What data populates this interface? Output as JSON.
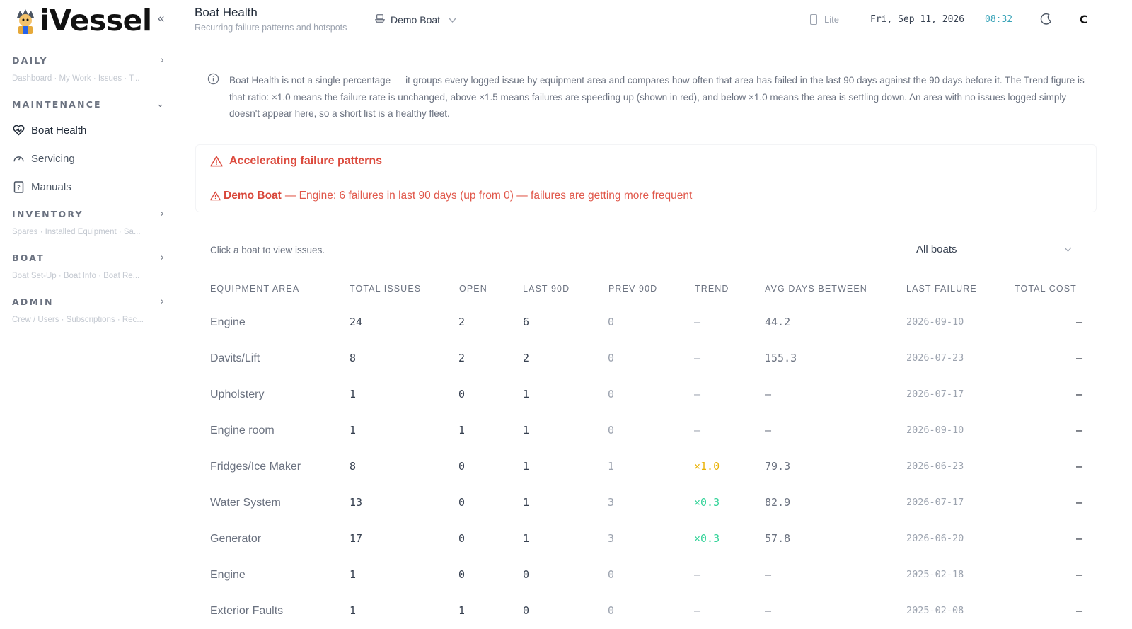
{
  "app": {
    "name": "iVessel"
  },
  "sidebar": {
    "sections": [
      {
        "title": "DAILY",
        "subtitle": "Dashboard · My Work · Issues · T..."
      },
      {
        "title": "MAINTENANCE"
      },
      {
        "title": "INVENTORY",
        "subtitle": "Spares · Installed Equipment · Sa..."
      },
      {
        "title": "BOAT",
        "subtitle": "Boat Set-Up · Boat Info · Boat Re..."
      },
      {
        "title": "ADMIN",
        "subtitle": "Crew / Users · Subscriptions · Rec..."
      }
    ],
    "maintenance_items": [
      {
        "label": "Boat Health",
        "icon": "heart-pulse-icon",
        "active": true
      },
      {
        "label": "Servicing",
        "icon": "gauge-icon",
        "active": false
      },
      {
        "label": "Manuals",
        "icon": "manual-icon",
        "active": false
      }
    ]
  },
  "header": {
    "title": "Boat Health",
    "subtitle": "Recurring failure patterns and hotspots",
    "boat": "Demo Boat",
    "lite_label": "Lite",
    "date": "Fri, Sep 11, 2026",
    "time": "08:32",
    "user_initial": "C"
  },
  "info": {
    "text": "Boat Health is not a single percentage — it groups every logged issue by equipment area and compares how often that area has failed in the last 90 days against the 90 days before it. The Trend figure is that ratio: ×1.0 means the failure rate is unchanged, above ×1.5 means failures are speeding up (shown in red), and below ×1.0 means the area is settling down. An area with no issues logged simply doesn't appear here, so a short list is a healthy fleet."
  },
  "alert": {
    "title": "Accelerating failure patterns",
    "boat": "Demo Boat",
    "message": "— Engine: 6 failures in last 90 days (up from 0) — failures are getting more frequent",
    "color": "#dc4a3d"
  },
  "table": {
    "hint": "Click a boat to view issues.",
    "filter": "All boats",
    "columns": [
      "EQUIPMENT AREA",
      "TOTAL ISSUES",
      "OPEN",
      "LAST 90D",
      "PREV 90D",
      "TREND",
      "AVG DAYS BETWEEN",
      "LAST FAILURE",
      "TOTAL COST"
    ],
    "trend_colors": {
      "flat": "#eab308",
      "settling": "#34d399"
    },
    "rows": [
      {
        "area": "Engine",
        "total": "24",
        "open": "2",
        "last90": "6",
        "prev90": "0",
        "trend": "—",
        "avg": "44.2",
        "last": "2026-09-10",
        "cost": "—"
      },
      {
        "area": "Davits/Lift",
        "total": "8",
        "open": "2",
        "last90": "2",
        "prev90": "0",
        "trend": "—",
        "avg": "155.3",
        "last": "2026-07-23",
        "cost": "—"
      },
      {
        "area": "Upholstery",
        "total": "1",
        "open": "0",
        "last90": "1",
        "prev90": "0",
        "trend": "—",
        "avg": "—",
        "last": "2026-07-17",
        "cost": "—"
      },
      {
        "area": "Engine room",
        "total": "1",
        "open": "1",
        "last90": "1",
        "prev90": "0",
        "trend": "—",
        "avg": "—",
        "last": "2026-09-10",
        "cost": "—"
      },
      {
        "area": "Fridges/Ice Maker",
        "total": "8",
        "open": "0",
        "last90": "1",
        "prev90": "1",
        "trend": "×1.0",
        "trend_state": "flat",
        "avg": "79.3",
        "last": "2026-06-23",
        "cost": "—"
      },
      {
        "area": "Water System",
        "total": "13",
        "open": "0",
        "last90": "1",
        "prev90": "3",
        "trend": "×0.3",
        "trend_state": "settling",
        "avg": "82.9",
        "last": "2026-07-17",
        "cost": "—"
      },
      {
        "area": "Generator",
        "total": "17",
        "open": "0",
        "last90": "1",
        "prev90": "3",
        "trend": "×0.3",
        "trend_state": "settling",
        "avg": "57.8",
        "last": "2026-06-20",
        "cost": "—"
      },
      {
        "area": "Engine",
        "total": "1",
        "open": "0",
        "last90": "0",
        "prev90": "0",
        "trend": "—",
        "avg": "—",
        "last": "2025-02-18",
        "cost": "—"
      },
      {
        "area": "Exterior Faults",
        "total": "1",
        "open": "1",
        "last90": "0",
        "prev90": "0",
        "trend": "—",
        "avg": "—",
        "last": "2025-02-08",
        "cost": "—"
      }
    ]
  }
}
